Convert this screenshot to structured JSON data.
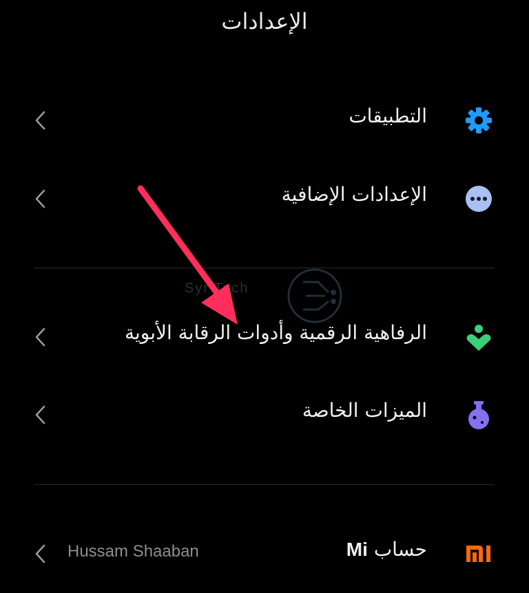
{
  "header": {
    "title": "الإعدادات"
  },
  "items": [
    {
      "label": "التطبيقات",
      "icon": "gear-icon",
      "color": "#1f9bff"
    },
    {
      "label": "الإعدادات الإضافية",
      "icon": "more-dots-icon",
      "color": "#a9c0f2"
    },
    {
      "label": "الرفاهية الرقمية وأدوات الرقابة الأبوية",
      "icon": "digital-wellbeing-icon",
      "color": "#3ad07a"
    },
    {
      "label": "الميزات الخاصة",
      "icon": "flask-icon",
      "color": "#8470f0"
    }
  ],
  "account": {
    "label_prefix": "حساب",
    "label_brand": "Mi",
    "value": "Hussam Shaaban",
    "icon": "mi-logo-icon",
    "color": "#ff6a00"
  },
  "annotation": {
    "arrow_color": "#ff2e5a"
  },
  "watermark": {
    "text": "Syr   Tech"
  }
}
